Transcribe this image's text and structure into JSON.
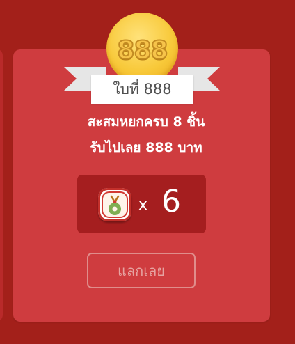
{
  "coin": {
    "label": "888",
    "icon": "gold-coin-icon"
  },
  "ribbon": {
    "label": "ใบที่ 888"
  },
  "description": {
    "line1": "สะสมหยกครบ 8 ชิ้น",
    "line2": "รับไปเลย 888 บาท"
  },
  "reward": {
    "icon": "jade-pendant-icon",
    "multiplier": "x",
    "count": "6"
  },
  "redeem_button": {
    "label": "แลกเลย",
    "enabled": false
  },
  "colors": {
    "background": "#a3201a",
    "card": "#cf3c3f",
    "reward_box": "#a51e1f",
    "coin_gold": "#f8c93a",
    "button_border": "#e08d8b"
  }
}
